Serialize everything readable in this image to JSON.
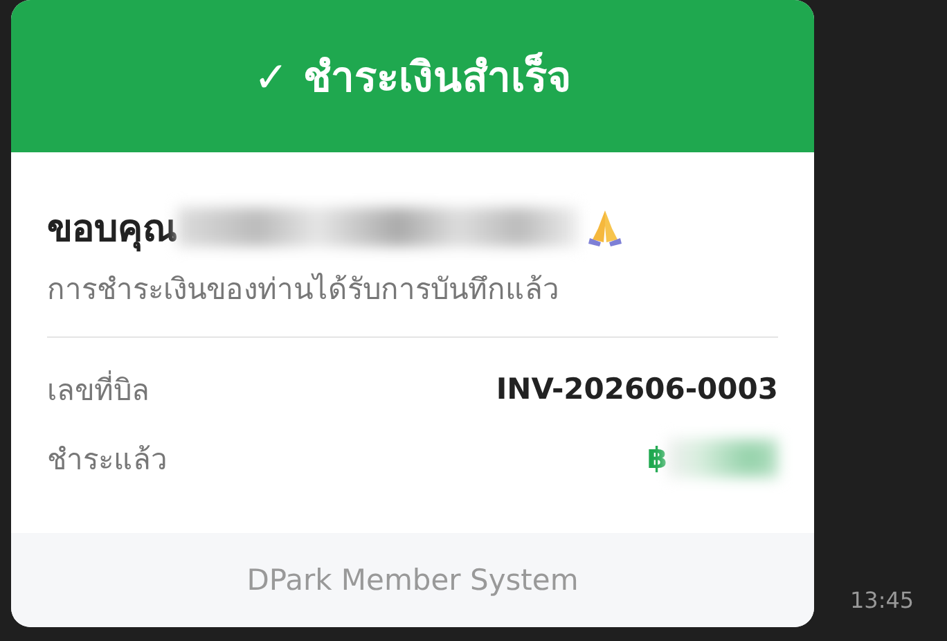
{
  "card": {
    "title": "✓ ชำระเงินสำเร็จ",
    "greeting": {
      "text": "ขอบคุณ",
      "name_redacted": true
    },
    "message": "การชำระเงินของท่านได้รับการบันทึกแล้ว",
    "rows": [
      {
        "label": "เลขที่บิล",
        "value": "INV-202606-0003",
        "kind": "text"
      },
      {
        "label": "ชำระแล้ว",
        "value": "฿",
        "kind": "amount",
        "redacted": true
      }
    ],
    "footer": "DPark Member System"
  },
  "time": "13:45"
}
